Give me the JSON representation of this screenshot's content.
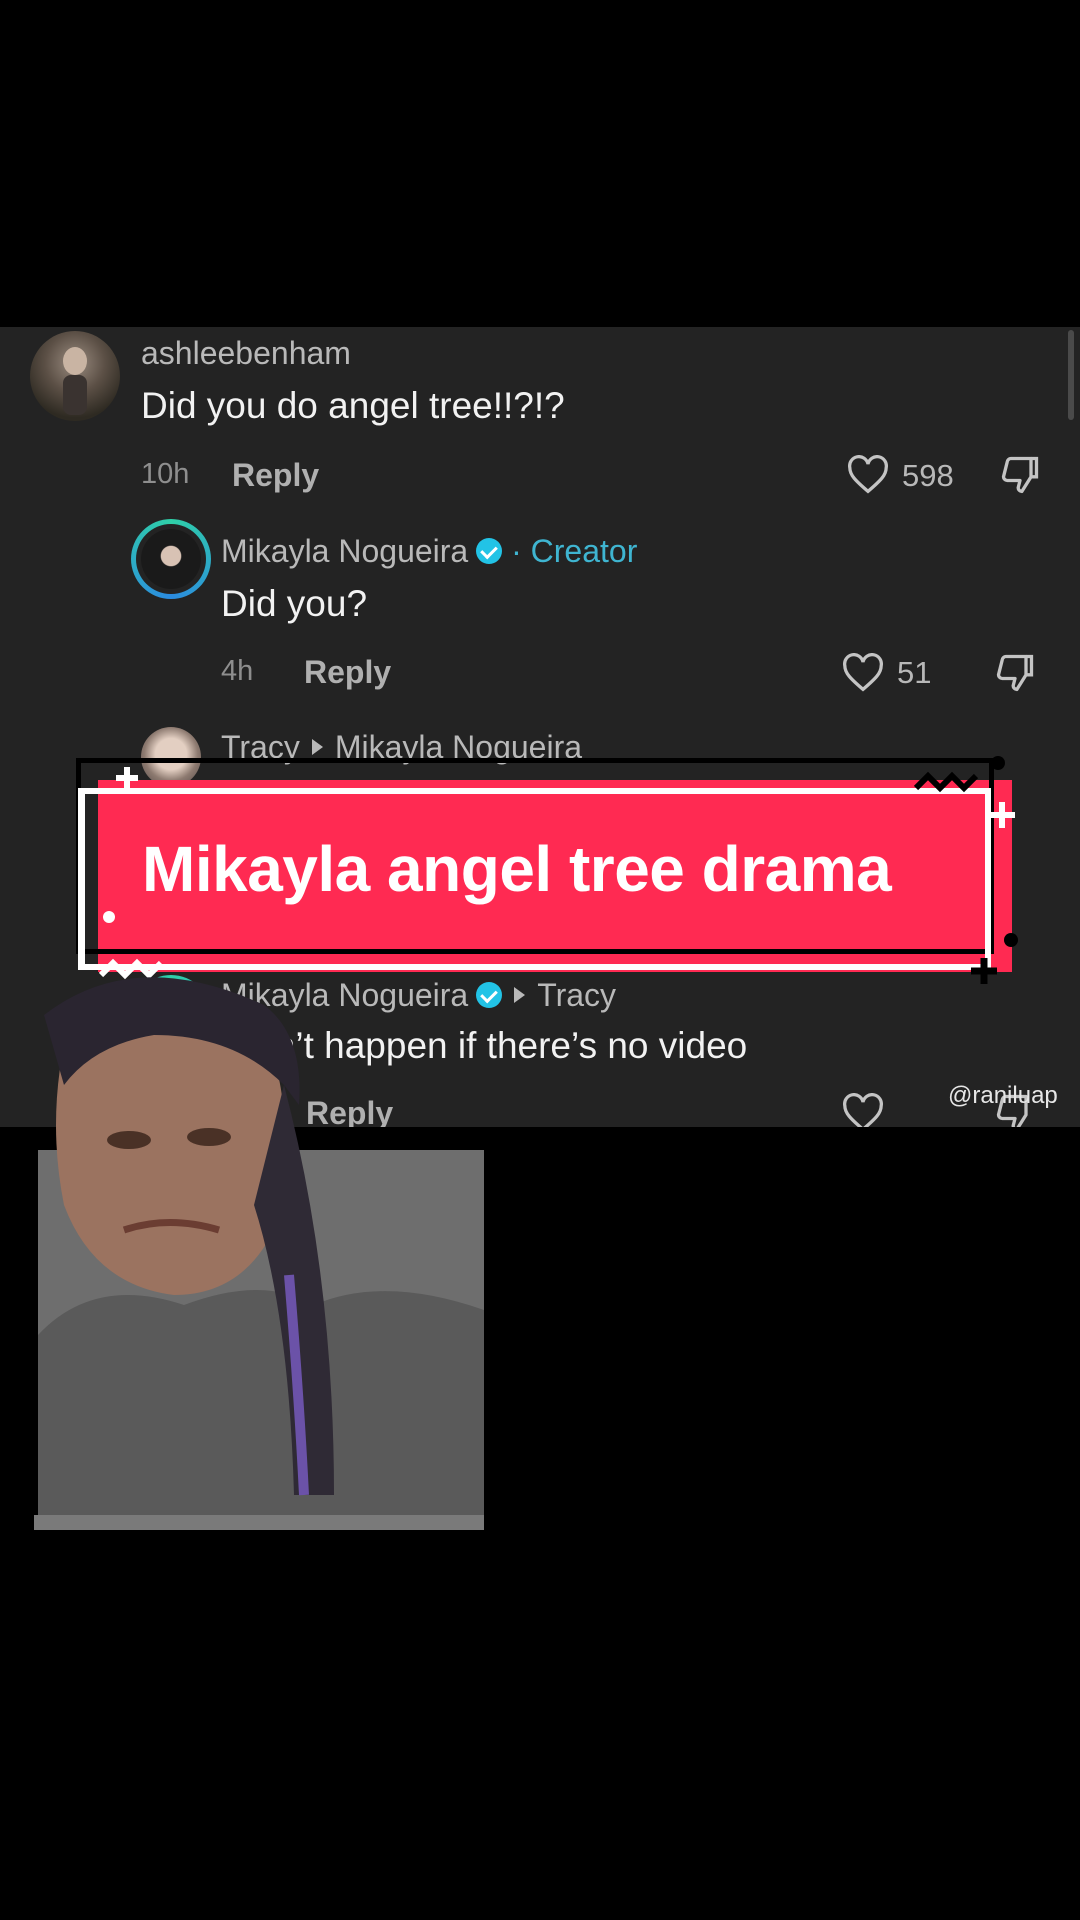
{
  "comments": [
    {
      "username": "ashleebenham",
      "text": "Did you do angel tree!!?!?",
      "time": "10h",
      "reply": "Reply",
      "likes": "598"
    },
    {
      "username": "Mikayla Nogueira",
      "creator_tag": "· Creator",
      "text": "Did you?",
      "time": "4h",
      "reply": "Reply",
      "likes": "51"
    },
    {
      "username": "Tracy",
      "reply_to": "Mikayla Nogueira"
    },
    {
      "username": "Mikayla Nogueira",
      "reply_to": "Tracy",
      "text": "idn’t happen if there’s no video",
      "reply": "Reply"
    }
  ],
  "overlay": {
    "title": "Mikayla angel tree drama",
    "watermark": "@raniluap"
  },
  "colors": {
    "panel": "#232323",
    "banner": "#ff2a52",
    "accent": "#22c3e6"
  }
}
